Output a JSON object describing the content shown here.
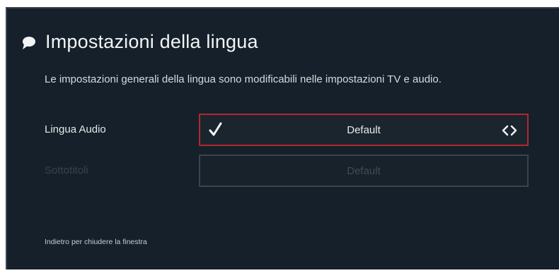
{
  "dialog": {
    "title": "Impostazioni della lingua",
    "icon": "chat-bubble-icon",
    "subtitle": "Le impostazioni generali della lingua sono modificabili nelle impostazioni TV e audio."
  },
  "settings": [
    {
      "label": "Lingua Audio",
      "value": "Default",
      "selected": true,
      "enabled": true
    },
    {
      "label": "Sottotitoli",
      "value": "Default",
      "selected": false,
      "enabled": false
    }
  ],
  "footer": {
    "hint": "Indietro per chiudere la finestra"
  },
  "colors": {
    "background": "#15202a",
    "focus_border": "#b3272e",
    "text": "#f2f4f5",
    "disabled_text": "#38434c"
  }
}
